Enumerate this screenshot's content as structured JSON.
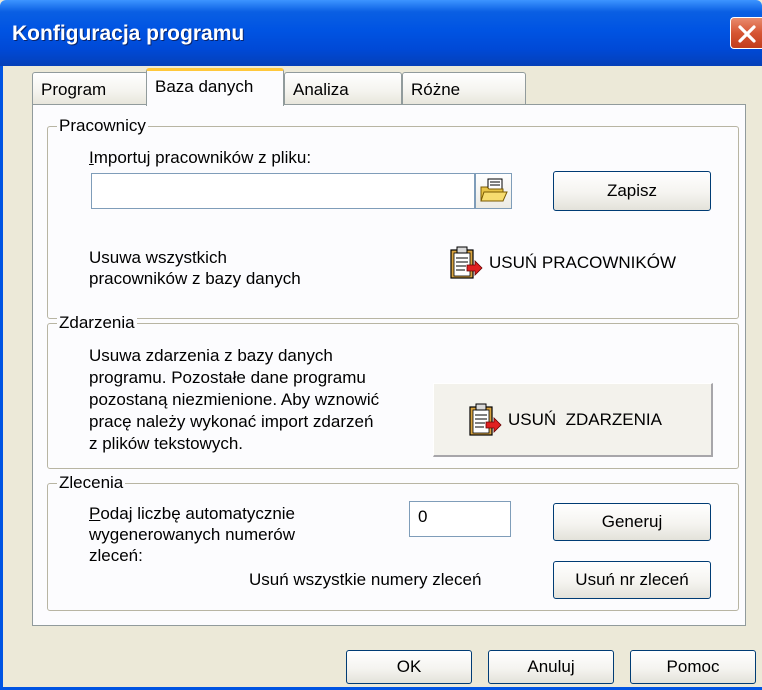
{
  "window": {
    "title": "Konfiguracja programu"
  },
  "tabs": [
    {
      "label": "Program",
      "selected": false
    },
    {
      "label": "Baza danych",
      "selected": true
    },
    {
      "label": "Analiza",
      "selected": false
    },
    {
      "label": "Różne",
      "selected": false
    }
  ],
  "pracownicy": {
    "group_title": "Pracownicy",
    "import_label_first": "I",
    "import_label_rest": "mportuj pracowników z pliku:",
    "import_value": "",
    "save_label": "Zapisz",
    "delete_line1": "Usuwa wszystkich",
    "delete_line2": "pracowników z bazy danych",
    "delete_button": "USUŃ PRACOWNIKÓW"
  },
  "zdarzenia": {
    "group_title": "Zdarzenia",
    "desc": [
      "Usuwa zdarzenia z bazy danych",
      "programu. Pozostałe dane programu",
      "pozostaną niezmienione. Aby wznowić",
      "pracę należy wykonać import zdarzeń",
      "z plików tekstowych."
    ],
    "delete_button": "USUŃ  ZDARZENIA"
  },
  "zlecenia": {
    "group_title": "Zlecenia",
    "count_label_first": "P",
    "count_label_rest": "odaj liczbę automatycznie",
    "count_label_line2": "wygenerowanych numerów",
    "count_label_line3": "zleceń:",
    "count_value": "0",
    "generate_button": "Generuj",
    "delete_all_label": "Usuń wszystkie numery zleceń",
    "delete_button": "Usuń nr zleceń"
  },
  "footer": {
    "ok": "OK",
    "cancel": "Anuluj",
    "help": "Pomoc"
  },
  "colors": {
    "titlebar": "#0054E3",
    "dialog": "#ECE9D8",
    "panel": "#FCFCFE",
    "tab_highlight": "#FFC83C",
    "close_button": "#D65533"
  },
  "icons": {
    "browse": "folder-open-icon",
    "delete_workers": "clipboard-arrow-icon",
    "delete_events": "clipboard-arrow-icon",
    "close": "close-icon"
  }
}
